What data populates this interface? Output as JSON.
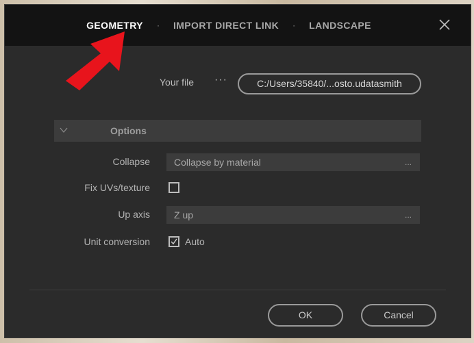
{
  "tabs": [
    {
      "label": "GEOMETRY",
      "active": true
    },
    {
      "label": "IMPORT DIRECT LINK",
      "active": false
    },
    {
      "label": "LANDSCAPE",
      "active": false
    }
  ],
  "tab_separator": "·",
  "file": {
    "label": "Your file",
    "browse_dots": "···",
    "path": "C:/Users/35840/...osto.udatasmith"
  },
  "options": {
    "title": "Options",
    "collapse": {
      "label": "Collapse",
      "value": "Collapse by material",
      "dots": "..."
    },
    "fix_uvs": {
      "label": "Fix UVs/texture",
      "checked": false
    },
    "up_axis": {
      "label": "Up axis",
      "value": "Z up",
      "dots": "..."
    },
    "unit_conversion": {
      "label": "Unit conversion",
      "checked": true,
      "check_label": "Auto"
    }
  },
  "buttons": {
    "ok": "OK",
    "cancel": "Cancel"
  },
  "colors": {
    "dialog_bg": "#2b2b2b",
    "header_bg": "#131313",
    "arrow": "#e8141c"
  },
  "icons": {
    "close": "close-icon",
    "chevron": "chevron-down-icon",
    "check": "checkmark-icon",
    "arrow": "red-arrow-annotation-icon"
  }
}
